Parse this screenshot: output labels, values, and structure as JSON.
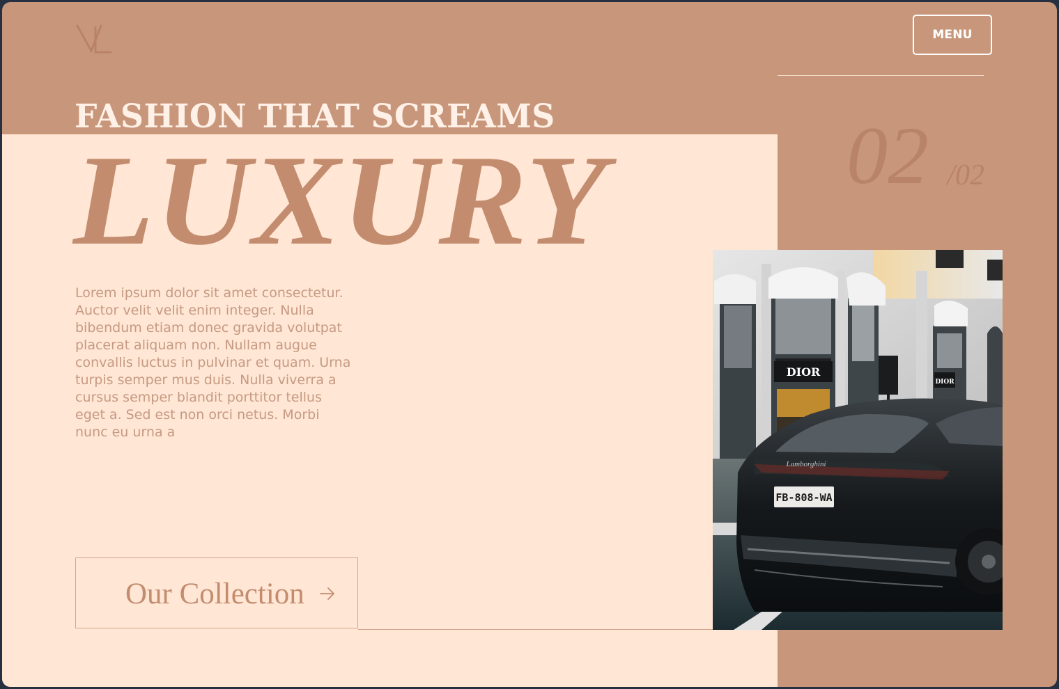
{
  "header": {
    "logo_alt": "VL monogram",
    "menu_label": "MENU"
  },
  "hero": {
    "headline_top": "FASHION THAT SCREAMS",
    "headline_main": "LUXURY",
    "body": "Lorem ipsum dolor sit amet consectetur. Auctor velit velit enim integer. Nulla bibendum etiam donec gravida volutpat placerat aliquam non. Nullam augue convallis luctus in pulvinar et quam. Urna turpis semper mus duis. Nulla viverra a cursus semper blandit porttitor tellus eget a. Sed est non orci netus. Morbi nunc eu urna a",
    "cta_label": "Our Collection"
  },
  "slider": {
    "current": "02",
    "total": "/02"
  },
  "photo": {
    "store_sign": "DIOR",
    "store_sign_small": "DIOR",
    "car_badge": "Lamborghini",
    "plate": "FB-808-WA"
  },
  "colors": {
    "tan": "#c8977b",
    "cream": "#ffe6d5",
    "accent_text": "#c38c6f",
    "frame": "#263040",
    "white": "#ffffff"
  },
  "icons": {
    "logo": "monogram-logo",
    "arrow": "arrow-right-icon"
  }
}
